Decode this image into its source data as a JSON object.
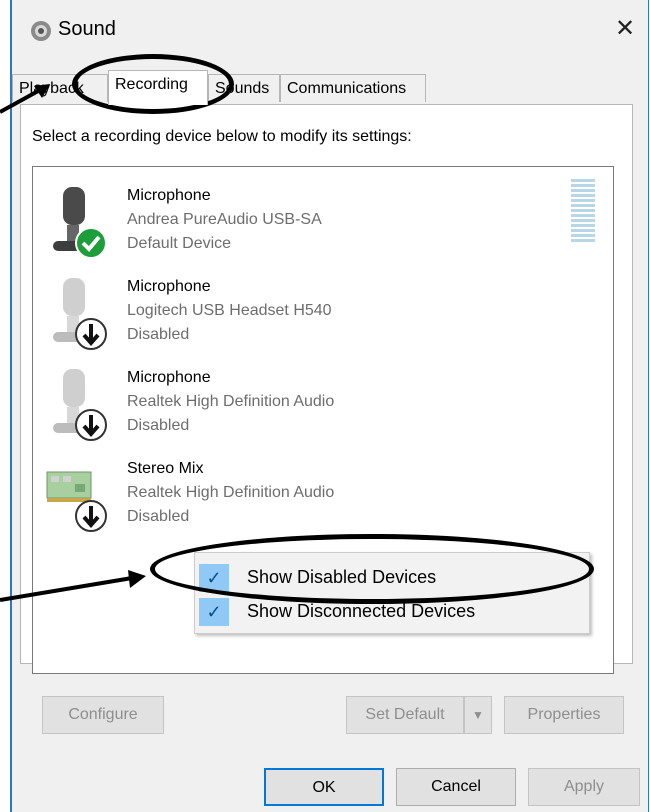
{
  "window": {
    "title": "Sound",
    "close_symbol": "✕"
  },
  "tabs": [
    {
      "label": "Playback"
    },
    {
      "label": "Recording"
    },
    {
      "label": "Sounds"
    },
    {
      "label": "Communications"
    }
  ],
  "instruction": "Select a recording device below to modify its settings:",
  "devices": [
    {
      "name": "Microphone",
      "description": "Andrea PureAudio USB-SA",
      "status": "Default Device",
      "icon": "microphone-default-icon"
    },
    {
      "name": "Microphone",
      "description": "Logitech USB Headset H540",
      "status": "Disabled",
      "icon": "microphone-disabled-icon"
    },
    {
      "name": "Microphone",
      "description": "Realtek High Definition Audio",
      "status": "Disabled",
      "icon": "microphone-disabled-icon"
    },
    {
      "name": "Stereo Mix",
      "description": "Realtek High Definition Audio",
      "status": "Disabled",
      "icon": "stereo-mix-disabled-icon"
    }
  ],
  "context_menu": [
    {
      "label": "Show Disabled Devices",
      "checked": true
    },
    {
      "label": "Show Disconnected Devices",
      "checked": true
    }
  ],
  "buttons": {
    "configure": "Configure",
    "set_default": "Set Default",
    "properties": "Properties",
    "ok": "OK",
    "cancel": "Cancel",
    "apply": "Apply"
  },
  "check_symbol": "✓",
  "colors": {
    "accent": "#0078d7",
    "check_bg": "#90c8f6",
    "default_badge": "#1e9e3a"
  }
}
